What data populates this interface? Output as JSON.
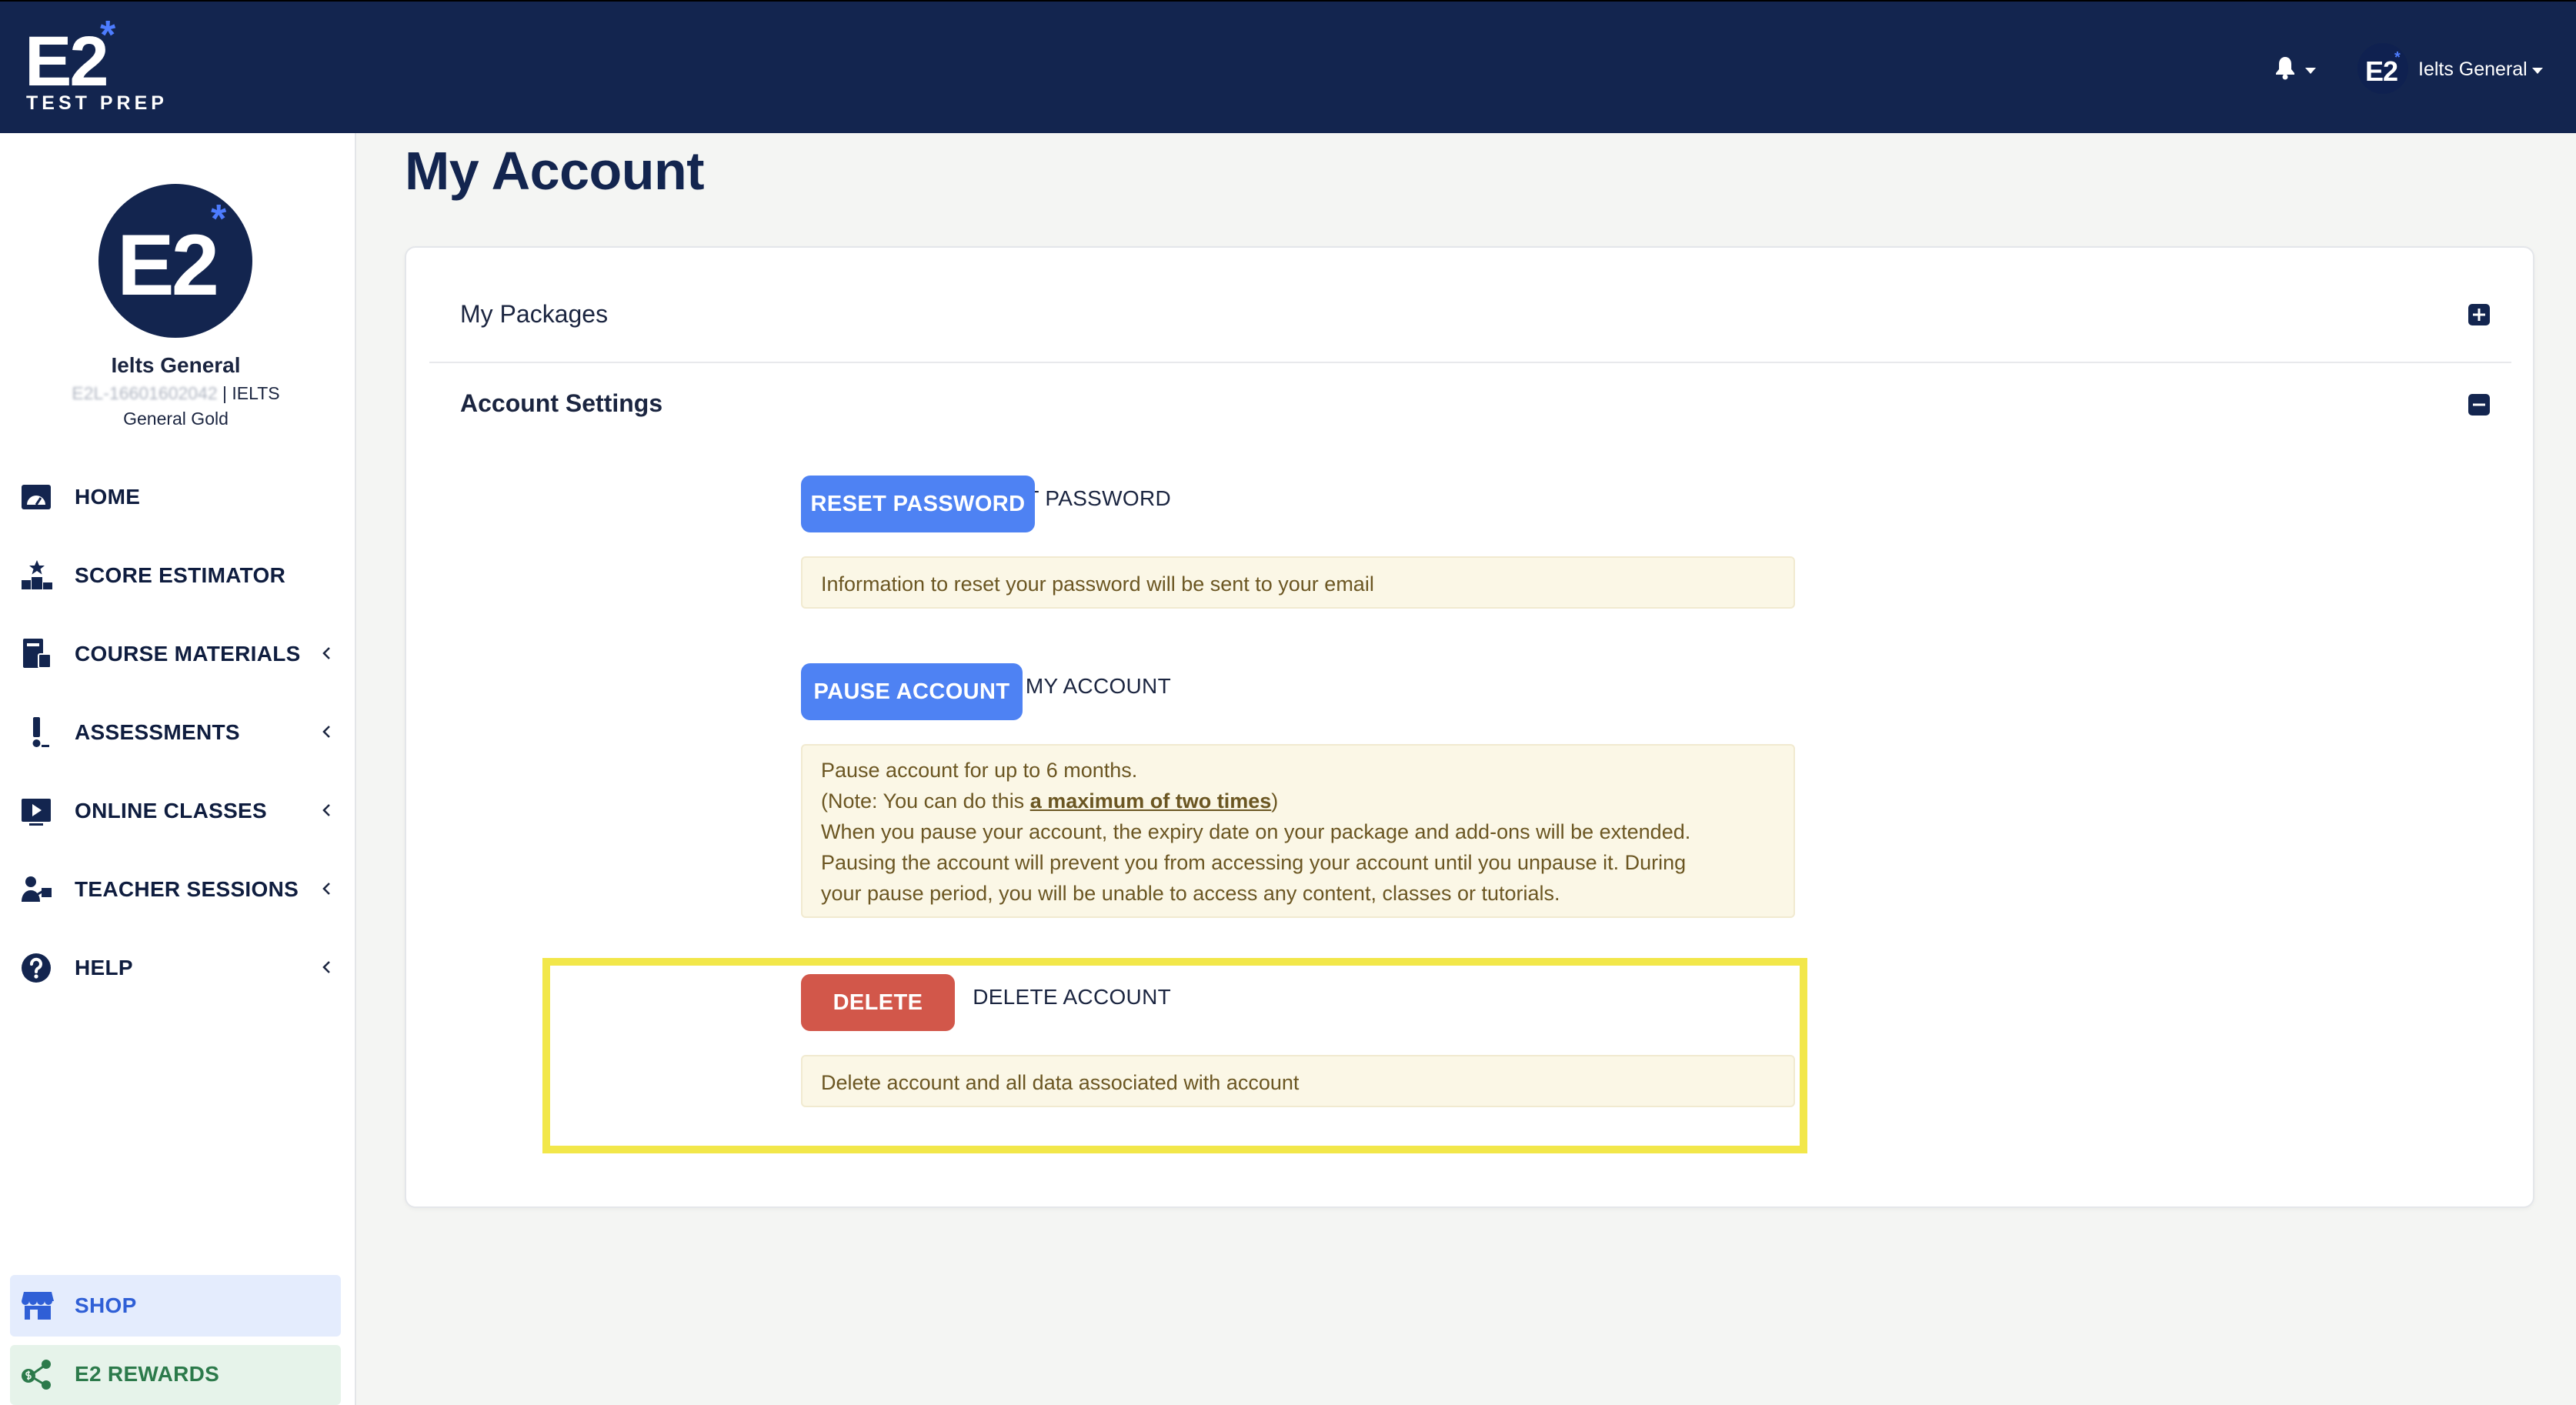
{
  "header": {
    "logo": {
      "mark": "E2",
      "star": "*",
      "subtitle": "TEST PREP"
    },
    "notifications_icon": "bell-icon",
    "user": {
      "avatar_text": "E2",
      "avatar_star": "*",
      "name": "Ielts General"
    }
  },
  "sidebar": {
    "profile": {
      "avatar_text": "E2",
      "avatar_star": "*",
      "name": "Ielts General",
      "id_blurred": "E2L-16601602042",
      "id_suffix": "| IELTS",
      "plan": "General Gold"
    },
    "nav": [
      {
        "label": "HOME",
        "icon": "gauge-icon",
        "has_submenu": false
      },
      {
        "label": "SCORE ESTIMATOR",
        "icon": "podium-star-icon",
        "has_submenu": false
      },
      {
        "label": "COURSE MATERIALS",
        "icon": "book-icon",
        "has_submenu": true
      },
      {
        "label": "ASSESSMENTS",
        "icon": "exclamation-icon",
        "has_submenu": true
      },
      {
        "label": "ONLINE CLASSES",
        "icon": "video-play-icon",
        "has_submenu": true
      },
      {
        "label": "TEACHER SESSIONS",
        "icon": "teacher-icon",
        "has_submenu": true
      },
      {
        "label": "HELP",
        "icon": "question-circle-icon",
        "has_submenu": true
      }
    ],
    "shop": {
      "label": "SHOP",
      "icon": "store-icon",
      "color": "#2f5fd6"
    },
    "rewards": {
      "label": "E2 REWARDS",
      "icon": "rewards-share-icon",
      "color": "#2c7a4b"
    }
  },
  "main": {
    "title": "My Account",
    "packages": {
      "title": "My Packages",
      "toggle": "plus-square-icon"
    },
    "settings": {
      "title": "Account Settings",
      "toggle": "minus-square-icon",
      "reset": {
        "label": "RESET PASSWORD",
        "button": "RESET PASSWORD",
        "note": "Information to reset your password will be sent to your email"
      },
      "pause": {
        "label": "PAUSE MY ACCOUNT",
        "button": "PAUSE ACCOUNT",
        "note_line1": "Pause account for up to 6 months.",
        "note_line2_pre": "(Note: You can do this ",
        "note_line2_link": "a maximum of two times",
        "note_line2_post": ")",
        "note_line3": "When you pause your account, the expiry date on your package and add-ons will be extended.",
        "note_line4": "Pausing the account will prevent you from accessing your account until you unpause it. During",
        "note_line5": "your pause period, you will be unable to access any content, classes or tutorials."
      },
      "delete": {
        "label": "DELETE ACCOUNT",
        "button": "DELETE",
        "note": "Delete account and all data associated with account"
      }
    }
  },
  "colors": {
    "header_bg": "#13254f",
    "accent_blue": "#4e82f3",
    "danger_red": "#d2574a",
    "note_bg": "#fbf7e6",
    "highlight": "#f2e74a",
    "star_blue": "#4d7cff"
  }
}
